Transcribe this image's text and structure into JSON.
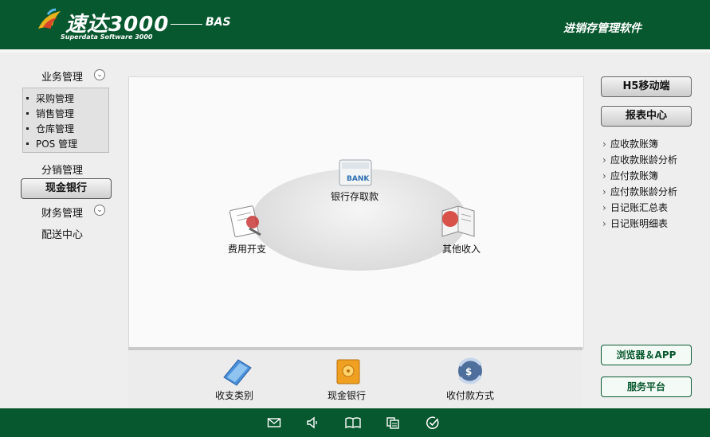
{
  "header": {
    "logo_main": "速达3000",
    "logo_edition": "BAS",
    "logo_sub": "Superdata Software 3000",
    "subtitle": "进销存管理软件"
  },
  "left_nav": {
    "business": "业务管理",
    "business_items": [
      "采购管理",
      "销售管理",
      "仓库管理",
      "POS 管理"
    ],
    "distribution": "分销管理",
    "cash_bank": "现金银行",
    "finance": "财务管理",
    "delivery": "配送中心"
  },
  "main": {
    "bank_label": "BANK",
    "items": {
      "bank_deposit": "银行存取款",
      "expense": "费用开支",
      "other_income": "其他收入"
    },
    "bottom": {
      "category": "收支类别",
      "cash_bank": "现金银行",
      "payment_method": "收付款方式"
    }
  },
  "right": {
    "h5_button": "H5移动端",
    "report_button": "报表中心",
    "links": [
      "应收款账簿",
      "应收款账龄分析",
      "应付款账簿",
      "应付款账龄分析",
      "日记账汇总表",
      "日记账明细表"
    ],
    "browser_button": "浏览器＆APP",
    "service_button": "服务平台"
  },
  "colors": {
    "brand_green": "#08582f"
  }
}
